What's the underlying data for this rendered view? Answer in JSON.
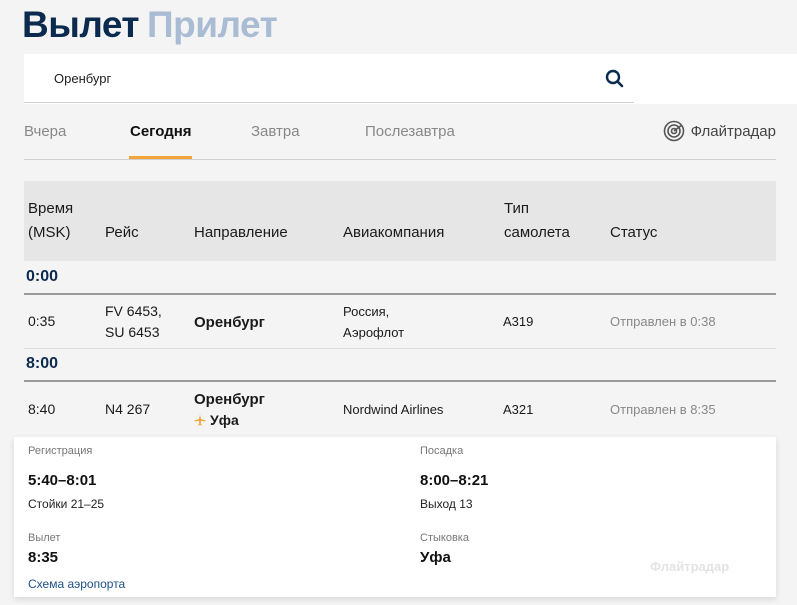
{
  "header": {
    "tab_active": "Вылет",
    "tab_inactive": "Прилет"
  },
  "search": {
    "value": "Оренбург"
  },
  "day_tabs": [
    "Вчера",
    "Сегодня",
    "Завтра",
    "Послезавтра"
  ],
  "radar_label": "Флайтрадар",
  "columns": {
    "time_line1": "Время",
    "time_line2": "(MSK)",
    "flight": "Рейс",
    "direction": "Направление",
    "airline": "Авиакомпания",
    "type_line1": "Тип",
    "type_line2": "самолета",
    "status": "Статус"
  },
  "groups": [
    {
      "label": "0:00",
      "rows": [
        {
          "time": "0:35",
          "flight_1": "FV 6453,",
          "flight_2": "SU 6453",
          "direction": "Оренбург",
          "airline_1": "Россия,",
          "airline_2": "Аэрофлот",
          "type": "A319",
          "status": "Отправлен в 0:38"
        }
      ]
    },
    {
      "label": "8:00",
      "rows": [
        {
          "time": "8:40",
          "flight_1": "N4 267",
          "direction": "Оренбург",
          "via": "Уфа",
          "airline_1": "Nordwind Airlines",
          "type": "A321",
          "status": "Отправлен в 8:35"
        }
      ]
    }
  ],
  "details": {
    "checkin_label": "Регистрация",
    "checkin_value": "5:40–8:01",
    "checkin_sub": "Стойки 21–25",
    "boarding_label": "Посадка",
    "boarding_value": "8:00–8:21",
    "boarding_sub": "Выход 13",
    "departure_label": "Вылет",
    "departure_value": "8:35",
    "transfer_label": "Стыковка",
    "transfer_value": "Уфа",
    "map_link": "Схема аэропорта",
    "watermark": "Флайтрадар"
  },
  "colors": {
    "brand": "#0b2a4e",
    "accent": "#f2a33a",
    "muted": "#a9bcd3"
  }
}
